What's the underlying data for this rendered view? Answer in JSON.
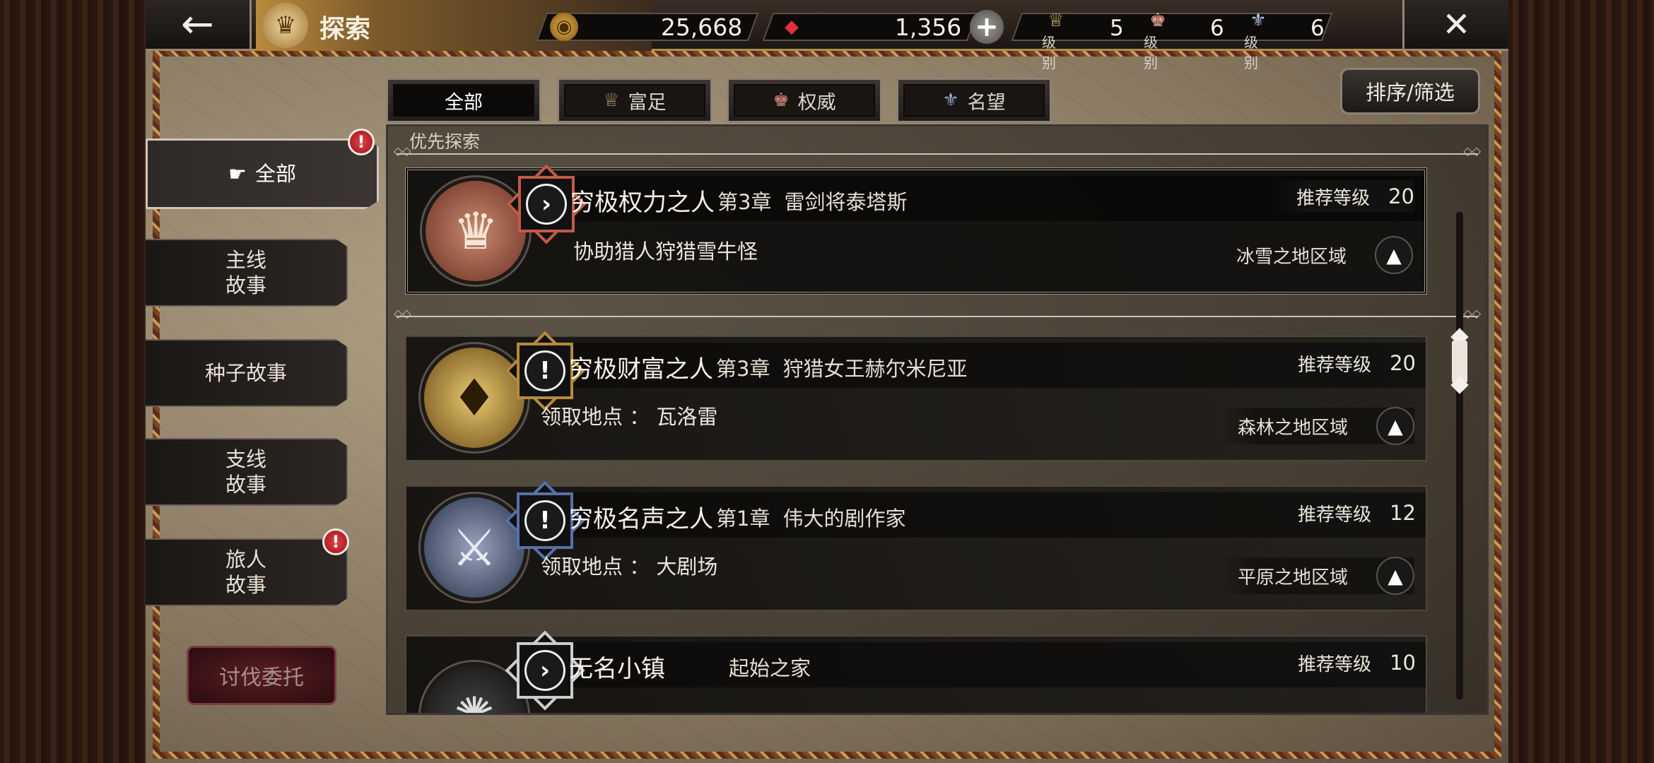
{
  "header": {
    "title": "探索",
    "gold": "25,668",
    "gems": "1,356",
    "levels": [
      {
        "caption": "级别",
        "value": "5",
        "icon": "wealth-crest-icon"
      },
      {
        "caption": "级别",
        "value": "6",
        "icon": "power-crest-icon"
      },
      {
        "caption": "级别",
        "value": "6",
        "icon": "fame-crest-icon"
      }
    ]
  },
  "tabs": [
    {
      "label": "全部",
      "icon": ""
    },
    {
      "label": "富足",
      "icon": "wealth-icon"
    },
    {
      "label": "权威",
      "icon": "power-icon"
    },
    {
      "label": "名望",
      "icon": "fame-icon"
    }
  ],
  "sort_label": "排序/筛选",
  "sidebar": {
    "items": [
      {
        "label": "全部"
      },
      {
        "line1": "主线",
        "line2": "故事"
      },
      {
        "label": "种子故事"
      },
      {
        "line1": "支线",
        "line2": "故事"
      },
      {
        "line1": "旅人",
        "line2": "故事"
      }
    ],
    "hunt_button": "讨伐委托"
  },
  "section_label": "优先探索",
  "rec_label": "推荐等级",
  "quests": [
    {
      "name": "穷极权力之人",
      "chapter": "第3章",
      "chapter_title": "雷剑将泰塔斯",
      "level": "20",
      "sub": "协助猎人狩猎雪牛怪",
      "region": "冰雪之地区域",
      "status": "arrow",
      "accent": "#c35a4a"
    },
    {
      "name": "穷极财富之人",
      "chapter": "第3章",
      "chapter_title": "狩猎女王赫尔米尼亚",
      "level": "20",
      "sub": "领取地点 ： 瓦洛雷",
      "region": "森林之地区域",
      "status": "new",
      "accent": "#b48a3c"
    },
    {
      "name": "穷极名声之人",
      "chapter": "第1章",
      "chapter_title": "伟大的剧作家",
      "level": "12",
      "sub": "领取地点 ： 大剧场",
      "region": "平原之地区域",
      "status": "new",
      "accent": "#5870a8"
    },
    {
      "name": "无名小镇",
      "chapter": "",
      "chapter_title": "起始之家",
      "level": "10",
      "sub": "",
      "region": "",
      "status": "arrow",
      "accent": "#cccccc"
    }
  ],
  "colors": {
    "accent_gold": "#b88a3d",
    "alert_red": "#d5323a"
  }
}
